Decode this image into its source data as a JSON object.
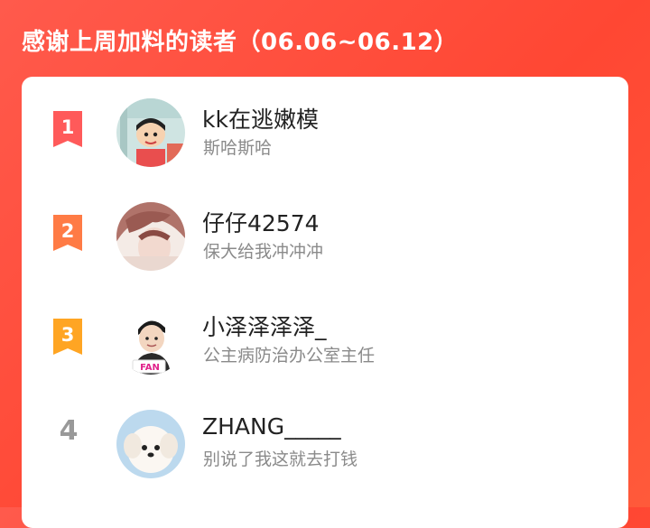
{
  "header": {
    "title": "感谢上周加料的读者（06.06~06.12）"
  },
  "readers": [
    {
      "rank": "1",
      "name": "kk在逃嫩模",
      "message": "斯哈斯哈",
      "rank_color": "#ff5a5a",
      "avatar_icon": "cartoon-boy-avatar"
    },
    {
      "rank": "2",
      "name": "仔仔42574",
      "message": "保大给我冲冲冲",
      "rank_color": "#ff7b45",
      "avatar_icon": "anime-boy-avatar"
    },
    {
      "rank": "3",
      "name": "小泽泽泽泽_",
      "message": "公主病防治办公室主任",
      "rank_color": "#ffa523",
      "avatar_icon": "3d-boy-avatar"
    },
    {
      "rank": "4",
      "name": "ZHANG_____",
      "message": "别说了我这就去打钱",
      "rank_color": "#999999",
      "avatar_icon": "white-puppy-avatar"
    }
  ],
  "badge_text": "FAN"
}
